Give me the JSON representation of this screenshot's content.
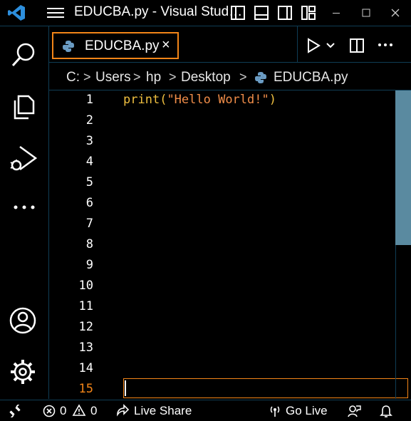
{
  "window": {
    "title": "EDUCBA.py - Visual Stud…",
    "controls": [
      "minimize-icon",
      "maximize-icon",
      "close-icon"
    ],
    "layout_icons": [
      "toggle-primary-sidebar-icon",
      "toggle-panel-icon",
      "toggle-secondary-sidebar-icon",
      "customize-layout-icon"
    ]
  },
  "activity_bar": {
    "items": [
      "search-icon",
      "explorer-icon",
      "run-debug-icon",
      "more-icon"
    ],
    "bottom_items": [
      "accounts-icon",
      "manage-gear-icon"
    ]
  },
  "editor_tab": {
    "label": "EDUCBA.py",
    "close": "×",
    "icon": "python-icon",
    "actions": [
      "run-icon",
      "run-dropdown-icon",
      "split-editor-icon",
      "more-actions-icon"
    ]
  },
  "breadcrumb": {
    "parts": [
      "C:",
      "Users",
      "hp",
      "Desktop",
      "EDUCBA.py"
    ],
    "separator": ">"
  },
  "editor": {
    "line_numbers": [
      "1",
      "2",
      "3",
      "4",
      "5",
      "6",
      "7",
      "8",
      "9",
      "10",
      "11",
      "12",
      "13",
      "14",
      "15"
    ],
    "active_line": "15",
    "code": {
      "fn": "print",
      "open_paren": "(",
      "string": "\"Hello World!\"",
      "close_paren": ")"
    }
  },
  "status_bar": {
    "remote_icon": "remote-icon",
    "errors": "0",
    "warnings": "0",
    "live_share": "Live Share",
    "go_live": "Go Live",
    "feedback_icon": "feedback-icon",
    "notifications_icon": "bell-icon"
  },
  "colors": {
    "accent": "#f38518",
    "border": "#0f3d55",
    "vscode_blue": "#2d8fdd",
    "string": "#f08d49",
    "function": "#f0c040"
  }
}
